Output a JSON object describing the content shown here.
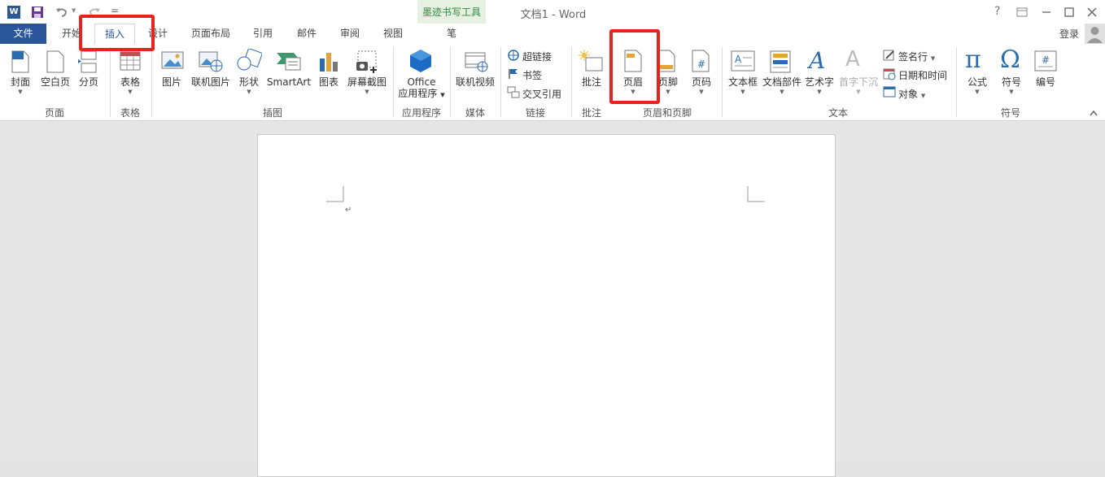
{
  "titlebar": {
    "title": "文档1 - Word",
    "context_tool_label": "墨迹书写工具",
    "help": "?",
    "quick_access_more": "="
  },
  "tabs": [
    {
      "label": "文件"
    },
    {
      "label": "开始"
    },
    {
      "label": "插入"
    },
    {
      "label": "设计"
    },
    {
      "label": "页面布局"
    },
    {
      "label": "引用"
    },
    {
      "label": "邮件"
    },
    {
      "label": "审阅"
    },
    {
      "label": "视图"
    },
    {
      "label": "笔"
    }
  ],
  "login": "登录",
  "ribbon": {
    "page_group": {
      "label": "页面",
      "items": [
        "封面",
        "空白页",
        "分页"
      ]
    },
    "table_group": {
      "label": "表格",
      "items": [
        "表格"
      ]
    },
    "illustrations_group": {
      "label": "插图",
      "items": [
        "图片",
        "联机图片",
        "形状",
        "SmartArt",
        "图表",
        "屏幕截图"
      ]
    },
    "apps_group": {
      "label": "应用程序",
      "items": [
        "Office",
        "应用程序"
      ]
    },
    "media_group": {
      "label": "媒体",
      "items": [
        "联机视频"
      ]
    },
    "links_group": {
      "label": "链接",
      "items": [
        "超链接",
        "书签",
        "交叉引用"
      ]
    },
    "comments_group": {
      "label": "批注",
      "items": [
        "批注"
      ]
    },
    "header_footer_group": {
      "label": "页眉和页脚",
      "items": [
        "页眉",
        "页脚",
        "页码"
      ]
    },
    "text_group": {
      "label": "文本",
      "items": [
        "文本框",
        "文档部件",
        "艺术字",
        "首字下沉",
        "签名行",
        "日期和时间",
        "对象"
      ]
    },
    "symbols_group": {
      "label": "符号",
      "items": [
        "公式",
        "符号",
        "编号"
      ]
    }
  },
  "colors": {
    "accent": "#2b579a",
    "highlight": "#e8231f",
    "context_green": "#2e8b3a"
  }
}
